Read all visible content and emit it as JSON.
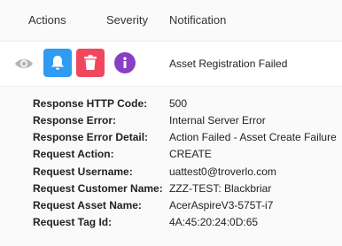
{
  "table": {
    "headers": {
      "actions": "Actions",
      "severity": "Severity",
      "notification": "Notification"
    },
    "row": {
      "notification": "Asset Registration Failed",
      "icons": {
        "view": "eye-icon",
        "alert": "bell-icon",
        "delete": "trash-icon",
        "severity": "info-icon"
      },
      "colors": {
        "alert_button": "#2f9bf3",
        "delete_button": "#f0475f",
        "severity_info": "#8a3ec7",
        "view_icon": "#b5b5b5"
      }
    },
    "details": [
      {
        "label": "Response HTTP Code:",
        "value": "500"
      },
      {
        "label": "Response Error:",
        "value": "Internal Server Error"
      },
      {
        "label": "Response Error Detail:",
        "value": "Action Failed - Asset Create Failure"
      },
      {
        "label": "Request Action:",
        "value": "CREATE"
      },
      {
        "label": "Request Username:",
        "value": "uattest0@troverlo.com"
      },
      {
        "label": "Request Customer Name:",
        "value": "ZZZ-TEST: Blackbriar"
      },
      {
        "label": "Request Asset Name:",
        "value": "AcerAspireV3-575T-i7"
      },
      {
        "label": "Request Tag Id:",
        "value": "4A:45:20:24:0D:65"
      }
    ]
  }
}
